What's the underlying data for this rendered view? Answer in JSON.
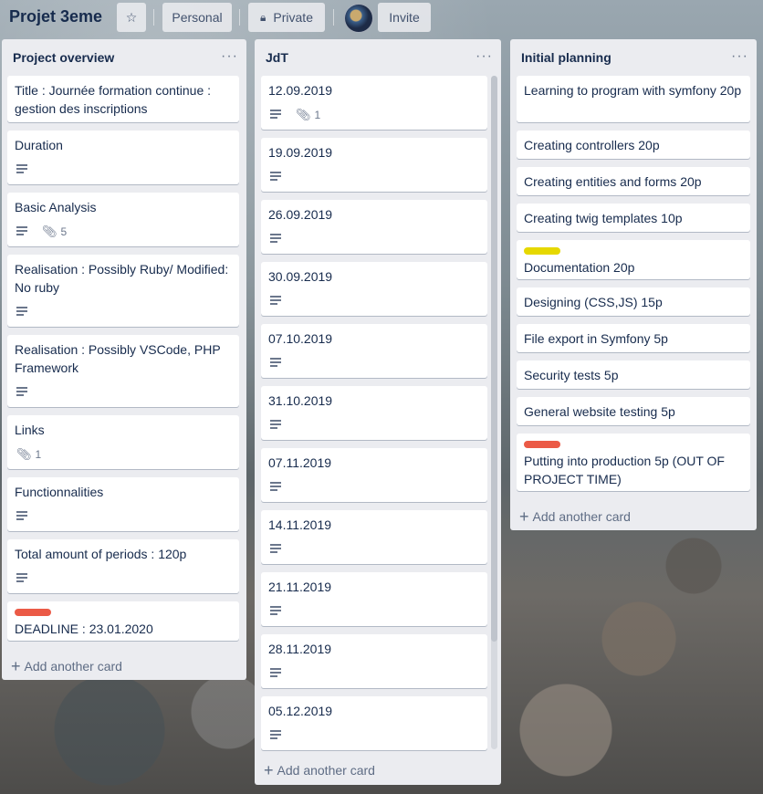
{
  "board": {
    "title": "Projet 3eme",
    "personal": "Personal",
    "private": "Private",
    "invite": "Invite"
  },
  "icons": {
    "star": "star-icon",
    "lock": "lock-icon",
    "description": "description-icon",
    "attachment": "attachment-icon",
    "more": "more-icon",
    "plus": "plus-icon"
  },
  "colors": {
    "label_yellow": "#e6d800",
    "label_red": "#eb5a46"
  },
  "lists": [
    {
      "title": "Project overview",
      "add_label": "Add another card",
      "cards": [
        {
          "text": "Title : Journée formation continue : gestion des inscriptions"
        },
        {
          "text": "Duration"
        },
        {
          "text": "Basic Analysis",
          "attachments": "5"
        },
        {
          "text": "Realisation : Possibly Ruby/ Modified: No ruby"
        },
        {
          "text": "Realisation : Possibly VSCode, PHP Framework"
        },
        {
          "text": "Links",
          "attachments": "1"
        },
        {
          "text": "Functionnalities"
        },
        {
          "text": "Total amount of periods : 120p"
        },
        {
          "text": "DEADLINE : 23.01.2020"
        }
      ]
    },
    {
      "title": "JdT",
      "add_label": "Add another card",
      "cards": [
        {
          "text": "12.09.2019",
          "attachments": "1"
        },
        {
          "text": "19.09.2019"
        },
        {
          "text": "26.09.2019"
        },
        {
          "text": "30.09.2019"
        },
        {
          "text": "07.10.2019"
        },
        {
          "text": "31.10.2019"
        },
        {
          "text": "07.11.2019"
        },
        {
          "text": "14.11.2019"
        },
        {
          "text": "21.11.2019"
        },
        {
          "text": "28.11.2019"
        },
        {
          "text": "05.12.2019"
        }
      ]
    },
    {
      "title": "Initial planning",
      "add_label": "Add another card",
      "cards": [
        {
          "text": "Learning to program with symfony 20p"
        },
        {
          "text": "Creating controllers 20p"
        },
        {
          "text": "Creating entities and forms 20p"
        },
        {
          "text": "Creating twig templates 10p"
        },
        {
          "text": "Documentation 20p"
        },
        {
          "text": "Designing (CSS,JS) 15p"
        },
        {
          "text": "File export in Symfony 5p"
        },
        {
          "text": "Security tests 5p"
        },
        {
          "text": "General website testing 5p"
        },
        {
          "text": "Putting into production 5p (OUT OF PROJECT TIME)"
        }
      ]
    }
  ]
}
